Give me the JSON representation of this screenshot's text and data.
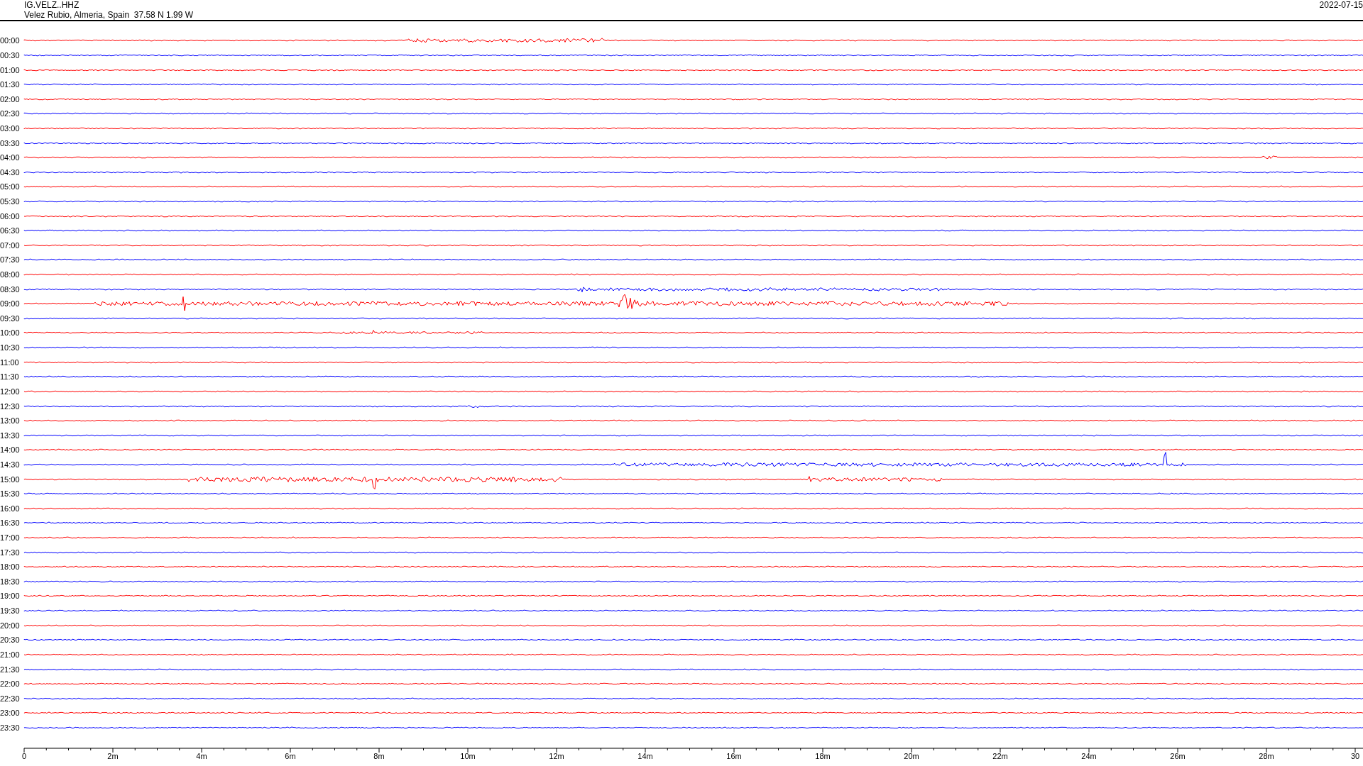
{
  "header": {
    "station": "IG.VELZ..HHZ",
    "location": "Velez Rubio, Almeria, Spain  37.58 N 1.99 W",
    "date": "2022-07-15"
  },
  "rows": [
    {
      "time": "00:00",
      "color": "#ff0000"
    },
    {
      "time": "00:30",
      "color": "#0000ff"
    },
    {
      "time": "01:00",
      "color": "#ff0000"
    },
    {
      "time": "01:30",
      "color": "#0000ff"
    },
    {
      "time": "02:00",
      "color": "#ff0000"
    },
    {
      "time": "02:30",
      "color": "#0000ff"
    },
    {
      "time": "03:00",
      "color": "#ff0000"
    },
    {
      "time": "03:30",
      "color": "#0000ff"
    },
    {
      "time": "04:00",
      "color": "#ff0000"
    },
    {
      "time": "04:30",
      "color": "#0000ff"
    },
    {
      "time": "05:00",
      "color": "#ff0000"
    },
    {
      "time": "05:30",
      "color": "#0000ff"
    },
    {
      "time": "06:00",
      "color": "#ff0000"
    },
    {
      "time": "06:30",
      "color": "#0000ff"
    },
    {
      "time": "07:00",
      "color": "#ff0000"
    },
    {
      "time": "07:30",
      "color": "#0000ff"
    },
    {
      "time": "08:00",
      "color": "#ff0000"
    },
    {
      "time": "08:30",
      "color": "#0000ff"
    },
    {
      "time": "09:00",
      "color": "#ff0000"
    },
    {
      "time": "09:30",
      "color": "#0000ff"
    },
    {
      "time": "10:00",
      "color": "#ff0000"
    },
    {
      "time": "10:30",
      "color": "#0000ff"
    },
    {
      "time": "11:00",
      "color": "#ff0000"
    },
    {
      "time": "11:30",
      "color": "#0000ff"
    },
    {
      "time": "12:00",
      "color": "#ff0000"
    },
    {
      "time": "12:30",
      "color": "#0000ff"
    },
    {
      "time": "13:00",
      "color": "#ff0000"
    },
    {
      "time": "13:30",
      "color": "#0000ff"
    },
    {
      "time": "14:00",
      "color": "#ff0000"
    },
    {
      "time": "14:30",
      "color": "#0000ff"
    },
    {
      "time": "15:00",
      "color": "#ff0000"
    },
    {
      "time": "15:30",
      "color": "#0000ff"
    },
    {
      "time": "16:00",
      "color": "#ff0000"
    },
    {
      "time": "16:30",
      "color": "#0000ff"
    },
    {
      "time": "17:00",
      "color": "#ff0000"
    },
    {
      "time": "17:30",
      "color": "#0000ff"
    },
    {
      "time": "18:00",
      "color": "#ff0000"
    },
    {
      "time": "18:30",
      "color": "#0000ff"
    },
    {
      "time": "19:00",
      "color": "#ff0000"
    },
    {
      "time": "19:30",
      "color": "#0000ff"
    },
    {
      "time": "20:00",
      "color": "#ff0000"
    },
    {
      "time": "20:30",
      "color": "#0000ff"
    },
    {
      "time": "21:00",
      "color": "#ff0000"
    },
    {
      "time": "21:30",
      "color": "#0000ff"
    },
    {
      "time": "22:00",
      "color": "#ff0000"
    },
    {
      "time": "22:30",
      "color": "#0000ff"
    },
    {
      "time": "23:00",
      "color": "#ff0000"
    },
    {
      "time": "23:30",
      "color": "#0000ff"
    }
  ],
  "x_axis": {
    "labels": [
      "0",
      "2m",
      "4m",
      "6m",
      "8m",
      "10m",
      "12m",
      "14m",
      "16m",
      "18m",
      "20m",
      "22m",
      "24m",
      "26m",
      "28m",
      "30"
    ]
  }
}
